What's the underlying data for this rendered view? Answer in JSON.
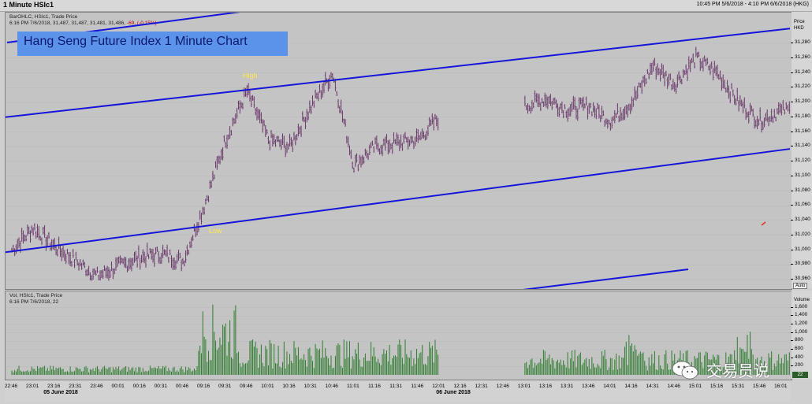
{
  "window": {
    "title": "1 Minute HSIc1",
    "time_range": "10:45 PM 5/6/2018 - 4:10 PM 6/6/2018 (HKG)"
  },
  "legend": {
    "price_line1": "BarOHLC, HSIc1, Trade Price",
    "price_line2_prefix": "6:16 PM 7/6/2018, 31,487, 31,487, 31,481, 31,486,",
    "price_line2_change": "-69, (-0.15%)",
    "vol_line1": "Vol, HSIc1, Trade Price",
    "vol_line2": "6:16 PM 7/6/2018, 22"
  },
  "annotations": {
    "banner": "Hang Seng Future Index 1 Minute Chart",
    "high_label": "High",
    "low_label": "Low",
    "watermark": "交易员说"
  },
  "axis": {
    "price_title": "Price",
    "currency": "HKD",
    "auto_button": "Auto",
    "volume_title": "Volume",
    "volume_badge": "22",
    "price_ticks": [
      "31,280",
      "31,260",
      "31,240",
      "31,220",
      "31,200",
      "31,180",
      "31,160",
      "31,140",
      "31,120",
      "31,100",
      "31,080",
      "31,060",
      "31,040",
      "31,020",
      "31,000",
      "30,980",
      "30,960"
    ],
    "volume_ticks": [
      "1,600",
      "1,400",
      "1,200",
      "1,000",
      "800",
      "600",
      "400",
      "200"
    ],
    "time_ticks": [
      "22:46",
      "23:01",
      "23:16",
      "23:31",
      "23:46",
      "00:01",
      "00:16",
      "00:31",
      "00:46",
      "09:16",
      "09:31",
      "09:46",
      "10:01",
      "10:16",
      "10:31",
      "10:46",
      "11:01",
      "11:16",
      "11:31",
      "11:46",
      "12:01",
      "12:16",
      "12:31",
      "12:46",
      "13:01",
      "13:16",
      "13:31",
      "13:46",
      "14:01",
      "14:16",
      "14:31",
      "14:46",
      "15:01",
      "15:16",
      "15:31",
      "15:46",
      "16:01"
    ],
    "date_labels": [
      "05 June 2018",
      "06 June 2018"
    ]
  },
  "colors": {
    "bars": "#6a3a6a",
    "volume_bars": "#2f7d2f",
    "trend_lines": "#1515d8",
    "banner_bg": "#5b92ea",
    "annotation_text": "#ffe94a"
  },
  "chart_data": [
    {
      "type": "ohlc",
      "title": "Hang Seng Future Index 1 Minute Chart",
      "series": [
        {
          "name": "HSIc1",
          "field": "Trade Price"
        }
      ],
      "ylim": [
        30950,
        31290
      ],
      "anchors": [
        {
          "t": "22:46",
          "v": 31000
        },
        {
          "t": "23:01",
          "v": 31030
        },
        {
          "t": "23:16",
          "v": 31005
        },
        {
          "t": "23:31",
          "v": 30985
        },
        {
          "t": "23:46",
          "v": 30965
        },
        {
          "t": "00:01",
          "v": 30978
        },
        {
          "t": "00:16",
          "v": 30990
        },
        {
          "t": "00:31",
          "v": 30995
        },
        {
          "t": "00:46",
          "v": 30985
        },
        {
          "t": "09:16",
          "v": 31060
        },
        {
          "t": "09:31",
          "v": 31150
        },
        {
          "t": "09:46",
          "v": 31215
        },
        {
          "t": "10:01",
          "v": 31150
        },
        {
          "t": "10:16",
          "v": 31140
        },
        {
          "t": "10:31",
          "v": 31195
        },
        {
          "t": "10:46",
          "v": 31240
        },
        {
          "t": "11:01",
          "v": 31115
        },
        {
          "t": "11:16",
          "v": 31140
        },
        {
          "t": "11:31",
          "v": 31145
        },
        {
          "t": "11:46",
          "v": 31150
        },
        {
          "t": "12:01",
          "v": 31180
        },
        {
          "t": "13:01",
          "v": 31195
        },
        {
          "t": "13:16",
          "v": 31205
        },
        {
          "t": "13:31",
          "v": 31190
        },
        {
          "t": "13:46",
          "v": 31195
        },
        {
          "t": "14:01",
          "v": 31175
        },
        {
          "t": "14:16",
          "v": 31200
        },
        {
          "t": "14:31",
          "v": 31250
        },
        {
          "t": "14:46",
          "v": 31225
        },
        {
          "t": "15:01",
          "v": 31260
        },
        {
          "t": "15:16",
          "v": 31240
        },
        {
          "t": "15:31",
          "v": 31200
        },
        {
          "t": "15:46",
          "v": 31175
        },
        {
          "t": "16:01",
          "v": 31190
        }
      ],
      "trend_lines": [
        {
          "name": "upper channel",
          "from": {
            "t": "22:46",
            "v": 31180
          },
          "to": {
            "t": "16:10",
            "v": 31300
          }
        },
        {
          "name": "lower channel",
          "from": {
            "t": "22:46",
            "v": 30997
          },
          "to": {
            "t": "16:10",
            "v": 31137
          }
        }
      ]
    },
    {
      "type": "bar",
      "title": "Vol",
      "ylim": [
        0,
        1800
      ],
      "notes": "Volume spikes near 09:16-09:31 (~1,700) and around 14:16-14:31 (~1,200)"
    }
  ]
}
